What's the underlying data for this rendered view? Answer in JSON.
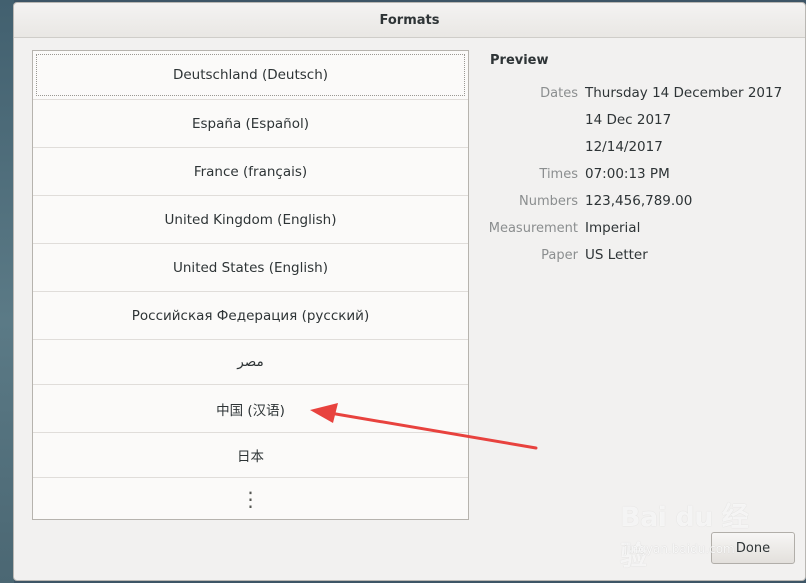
{
  "dialog": {
    "title": "Formats",
    "done_label": "Done"
  },
  "formats": [
    {
      "label": "Deutschland (Deutsch)",
      "selected": true
    },
    {
      "label": "España (Español)"
    },
    {
      "label": "France (français)"
    },
    {
      "label": "United Kingdom (English)"
    },
    {
      "label": "United States (English)"
    },
    {
      "label": "Российская Федерация (русский)"
    },
    {
      "label": "مصر"
    },
    {
      "label": "中国 (汉语)"
    },
    {
      "label": "日本"
    }
  ],
  "more_label": "⋮",
  "preview": {
    "title": "Preview",
    "dates_label": "Dates",
    "dates": [
      "Thursday 14 December 2017",
      "14 Dec 2017",
      "12/14/2017"
    ],
    "times_label": "Times",
    "times": "07:00:13 PM",
    "numbers_label": "Numbers",
    "numbers": "123,456,789.00",
    "measurement_label": "Measurement",
    "measurement": "Imperial",
    "paper_label": "Paper",
    "paper": "US Letter"
  },
  "watermark": {
    "brand": "Bai du 经验",
    "sub": "jingyan.baidu.com"
  },
  "colors": {
    "arrow": "#e8423e",
    "accent": "#2e3436"
  }
}
